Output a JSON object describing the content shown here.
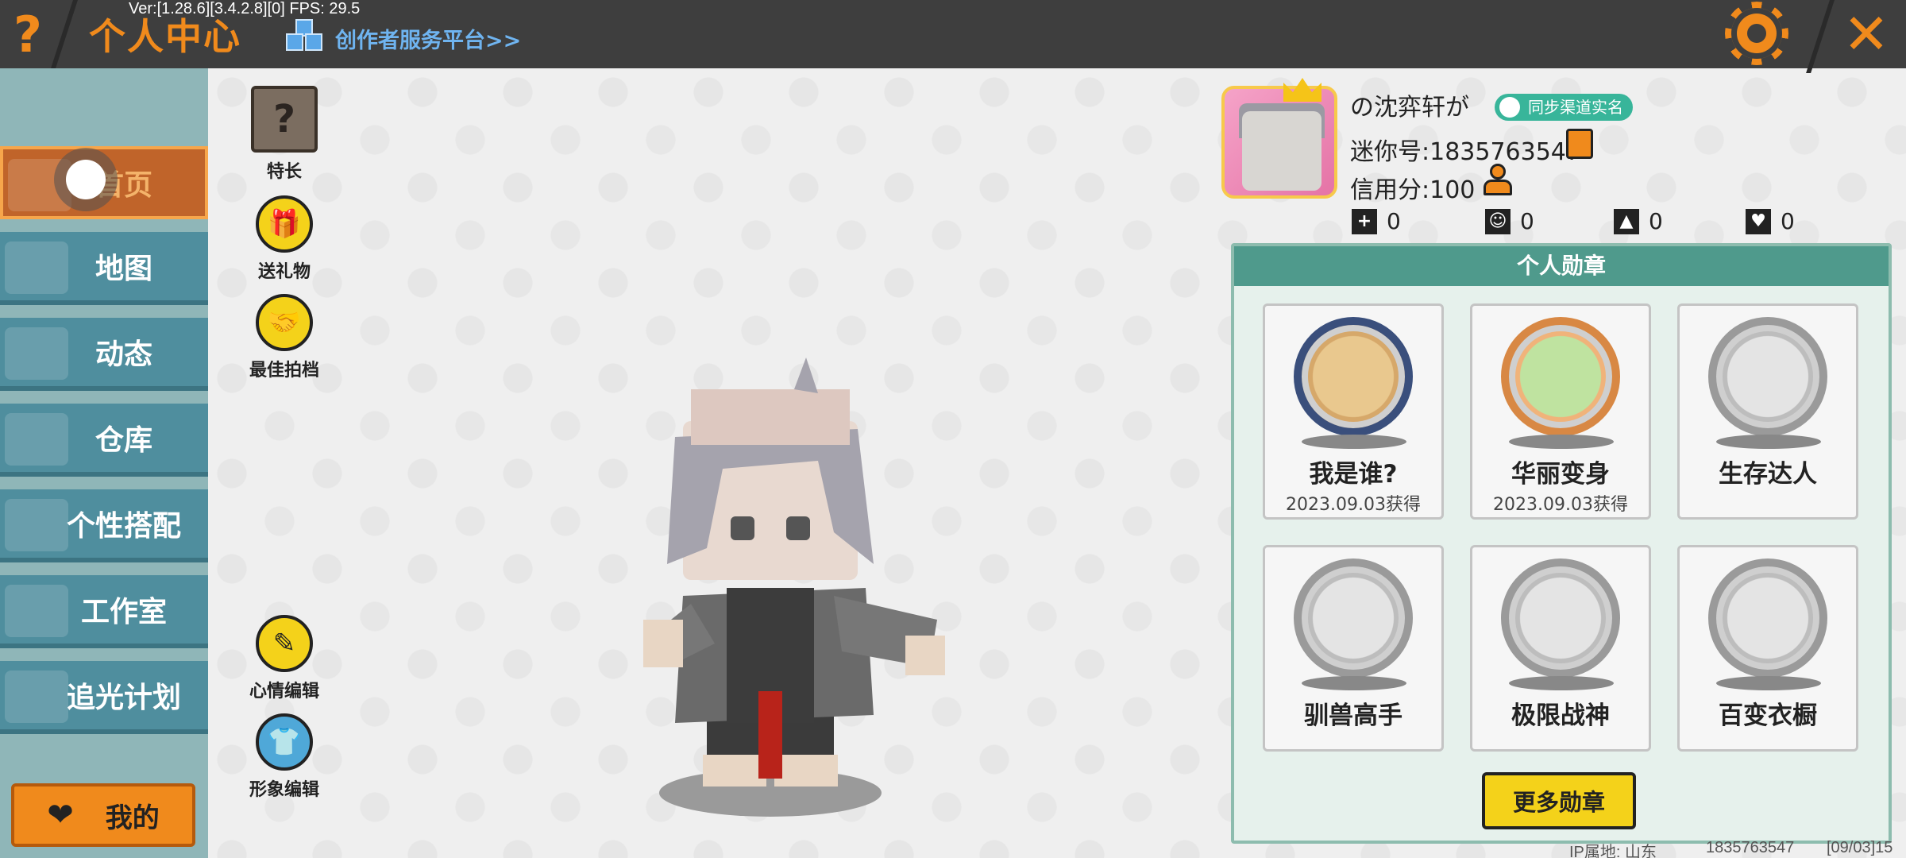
{
  "header": {
    "title": "个人中心",
    "version_info": "Ver:[1.28.6][3.4.2.8][0] FPS: 29.5",
    "creator_link": "创作者服务平台>>"
  },
  "sidebar": {
    "items": [
      {
        "label": "首页",
        "active": true
      },
      {
        "label": "地图"
      },
      {
        "label": "动态"
      },
      {
        "label": "仓库"
      },
      {
        "label": "个性搭配"
      },
      {
        "label": "工作室"
      },
      {
        "label": "追光计划"
      }
    ],
    "mine_label": "我的"
  },
  "actions": {
    "specialty": "特长",
    "send_gift": "送礼物",
    "best_shot": "最佳拍档",
    "mood_edit": "心情编辑",
    "avatar_edit": "形象编辑"
  },
  "profile": {
    "username": "の沈弈轩が",
    "sync_badge": "同步渠道实名",
    "mini_id": "迷你号:1835763547",
    "credit": "信用分:100",
    "stats": [
      "0",
      "0",
      "0",
      "0"
    ]
  },
  "medals": {
    "title": "个人勋章",
    "items": [
      {
        "name": "我是谁?",
        "date": "2023.09.03获得"
      },
      {
        "name": "华丽变身",
        "date": "2023.09.03获得"
      },
      {
        "name": "生存达人",
        "date": ""
      },
      {
        "name": "驯兽高手",
        "date": ""
      },
      {
        "name": "极限战神",
        "date": ""
      },
      {
        "name": "百变衣橱",
        "date": ""
      }
    ],
    "more_label": "更多勋章"
  },
  "footer": {
    "ip_location": "IP属地: 山东",
    "uid": "1835763547",
    "date": "[09/03]15"
  },
  "colors": {
    "accent": "#f08a1c",
    "sidebar": "#4f8e9e",
    "panel_header": "#4f9a8c",
    "button_yellow": "#f4d21a"
  }
}
